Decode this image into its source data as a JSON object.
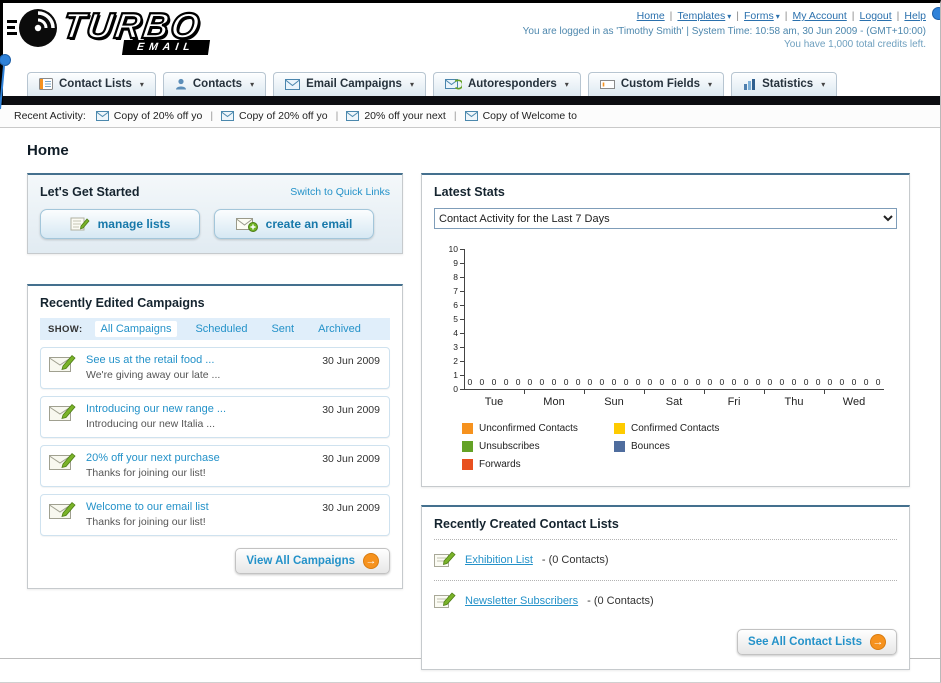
{
  "glyphs": {
    "caret": "▾",
    "separator": "|",
    "arrow": "→"
  },
  "colors": {
    "link": "#2492c9",
    "accent_orange": "#f6921e",
    "nav_dark_bar": "#0c0d11"
  },
  "page": {
    "title": "Home"
  },
  "header": {
    "logo": {
      "brand": "TURBO",
      "sub": "EMAIL"
    },
    "top_links": [
      {
        "label": "Home",
        "dropdown": false
      },
      {
        "label": "Templates",
        "dropdown": true
      },
      {
        "label": "Forms",
        "dropdown": true
      },
      {
        "label": "My Account",
        "dropdown": false
      },
      {
        "label": "Logout",
        "dropdown": false
      },
      {
        "label": "Help",
        "dropdown": false
      }
    ],
    "login_status": "You are logged in as 'Timothy Smith' | System Time: 10:58 am, 30 Jun 2009 - (GMT+10:00)",
    "credits_note": "You have 1,000 total credits left."
  },
  "nav": {
    "items": [
      {
        "label": "Contact Lists",
        "icon": "contact-lists-icon"
      },
      {
        "label": "Contacts",
        "icon": "contacts-icon"
      },
      {
        "label": "Email Campaigns",
        "icon": "email-campaigns-icon"
      },
      {
        "label": "Autoresponders",
        "icon": "autoresponders-icon"
      },
      {
        "label": "Custom Fields",
        "icon": "custom-fields-icon"
      },
      {
        "label": "Statistics",
        "icon": "statistics-icon"
      }
    ]
  },
  "recent_activity": {
    "label": "Recent Activity:",
    "items": [
      "Copy of 20% off yo",
      "Copy of 20% off yo",
      "20% off your next",
      "Copy of Welcome to"
    ]
  },
  "get_started": {
    "title": "Let's Get Started",
    "switch_link": "Switch to Quick Links",
    "manage_lists_label": "manage lists",
    "create_email_label": "create an email"
  },
  "campaigns": {
    "title": "Recently Edited Campaigns",
    "show_label": "SHOW:",
    "tabs": [
      "All Campaigns",
      "Scheduled",
      "Sent",
      "Archived"
    ],
    "active_tab": "All Campaigns",
    "rows": [
      {
        "title": "See us at the retail food ...",
        "subtitle": "We're giving away our late ...",
        "date": "30 Jun 2009"
      },
      {
        "title": "Introducing our new range ...",
        "subtitle": "Introducing our new Italia ...",
        "date": "30 Jun 2009"
      },
      {
        "title": "20% off your next purchase",
        "subtitle": "Thanks for joining our list!",
        "date": "30 Jun 2009"
      },
      {
        "title": "Welcome to our email list",
        "subtitle": "Thanks for joining our list!",
        "date": "30 Jun 2009"
      }
    ],
    "view_all_label": "View All Campaigns"
  },
  "latest_stats": {
    "title": "Latest Stats",
    "selected_filter": "Contact Activity for the Last 7 Days",
    "chart_data": {
      "type": "bar",
      "title": "Contact Activity for the Last 7 Days",
      "categories": [
        "Tue",
        "Mon",
        "Sun",
        "Sat",
        "Fri",
        "Thu",
        "Wed"
      ],
      "series": [
        {
          "name": "Unconfirmed Contacts",
          "color": "#f6921e",
          "values": [
            0,
            0,
            0,
            0,
            0,
            0,
            0
          ]
        },
        {
          "name": "Confirmed Contacts",
          "color": "#fecb00",
          "values": [
            0,
            0,
            0,
            0,
            0,
            0,
            0
          ]
        },
        {
          "name": "Unsubscribes",
          "color": "#64a226",
          "values": [
            0,
            0,
            0,
            0,
            0,
            0,
            0
          ]
        },
        {
          "name": "Bounces",
          "color": "#4f6d9e",
          "values": [
            0,
            0,
            0,
            0,
            0,
            0,
            0
          ]
        },
        {
          "name": "Forwards",
          "color": "#e8501f",
          "values": [
            0,
            0,
            0,
            0,
            0,
            0,
            0
          ]
        }
      ],
      "ylim": [
        0,
        10
      ],
      "ytick_step": 1,
      "grid": false,
      "legend_position": "bottom"
    }
  },
  "contact_lists": {
    "title": "Recently Created Contact Lists",
    "items": [
      {
        "name": "Exhibition List",
        "suffix": "- (0 Contacts)"
      },
      {
        "name": "Newsletter Subscribers",
        "suffix": "- (0 Contacts)"
      }
    ],
    "see_all_label": "See All Contact Lists"
  }
}
